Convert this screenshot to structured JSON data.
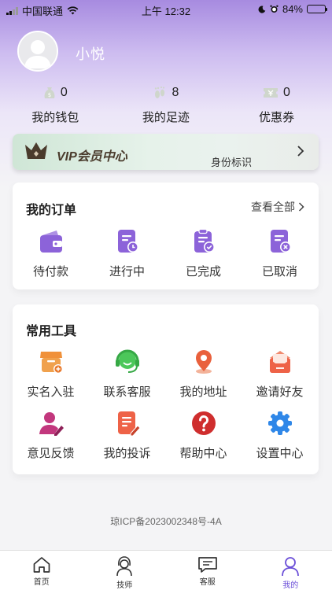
{
  "status_bar": {
    "carrier": "中国联通",
    "time": "上午 12:32",
    "battery": "84%",
    "battery_level": 0.84
  },
  "profile": {
    "username": "小悦"
  },
  "stats": [
    {
      "icon": "wallet-bag-icon",
      "count": "0",
      "label": "我的钱包"
    },
    {
      "icon": "footprint-icon",
      "count": "8",
      "label": "我的足迹"
    },
    {
      "icon": "coupon-icon",
      "count": "0",
      "label": "优惠券"
    }
  ],
  "vip": {
    "title": "VIP会员中心",
    "subtitle": "身份标识"
  },
  "orders": {
    "title": "我的订单",
    "view_all": "查看全部",
    "items": [
      {
        "icon": "wallet-icon",
        "label": "待付款"
      },
      {
        "icon": "document-clock-icon",
        "label": "进行中"
      },
      {
        "icon": "clipboard-check-icon",
        "label": "已完成"
      },
      {
        "icon": "document-cancel-icon",
        "label": "已取消"
      }
    ]
  },
  "tools": {
    "title": "常用工具",
    "items": [
      {
        "icon": "store-add-icon",
        "label": "实名入驻"
      },
      {
        "icon": "headset-icon",
        "label": "联系客服"
      },
      {
        "icon": "location-pin-icon",
        "label": "我的地址"
      },
      {
        "icon": "mail-invite-icon",
        "label": "邀请好友"
      },
      {
        "icon": "user-edit-icon",
        "label": "意见反馈"
      },
      {
        "icon": "document-edit-icon",
        "label": "我的投诉"
      },
      {
        "icon": "help-icon",
        "label": "帮助中心"
      },
      {
        "icon": "gear-icon",
        "label": "设置中心"
      }
    ]
  },
  "footer": {
    "icp": "琼ICP备2023002348号-4A"
  },
  "tabbar": [
    {
      "icon": "home-icon",
      "label": "首页"
    },
    {
      "icon": "technician-icon",
      "label": "技师"
    },
    {
      "icon": "message-icon",
      "label": "客服"
    },
    {
      "icon": "profile-icon",
      "label": "我的",
      "active": true
    }
  ],
  "colors": {
    "accent": "#6b4fd8",
    "order_icon": "#8c63d9",
    "vip_text": "#4a3b2c"
  }
}
